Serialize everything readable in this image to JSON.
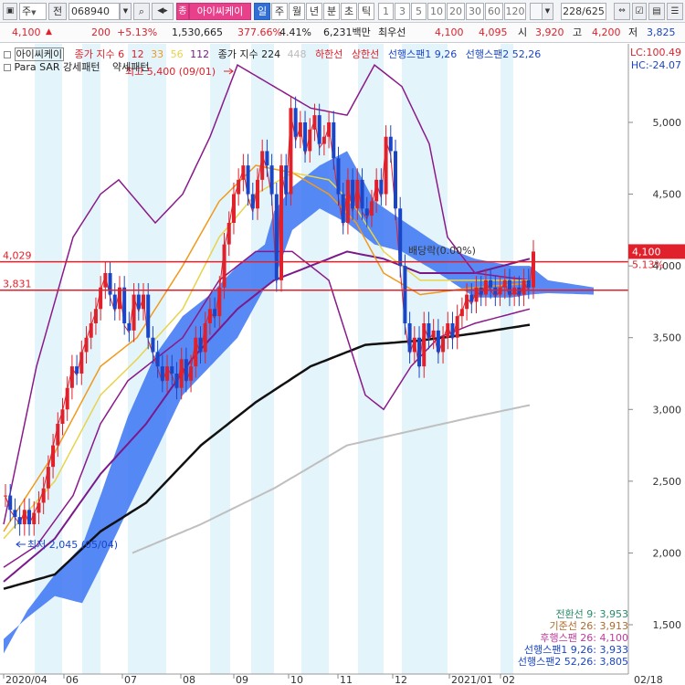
{
  "toolbar": {
    "market": "주",
    "code_prefix": "전",
    "code": "068940",
    "stock_name_badge": "종",
    "stock_name": "아이씨케이",
    "periods": [
      "일",
      "주",
      "월",
      "년",
      "분",
      "초",
      "틱"
    ],
    "active_period": "일",
    "intervals": [
      "1",
      "3",
      "5",
      "10",
      "20",
      "30",
      "60",
      "120"
    ],
    "page_counter": "228/625"
  },
  "quote": {
    "price": "4,100",
    "change": "200",
    "change_pct": "+5.13%",
    "volume": "1,530,665",
    "volume_ratio": "377.66%",
    "turnover": "4.41%",
    "amount": "6,231백만",
    "priority_label": "최우선",
    "ask": "4,100",
    "bid": "4,095",
    "open_label": "시",
    "open": "3,920",
    "high_label": "고",
    "high": "4,200",
    "low_label": "저",
    "low": "3,825"
  },
  "legend": {
    "stock_label": "아이씨케이",
    "ma_label": "종가 지수",
    "ma_values": [
      "6",
      "12",
      "33",
      "56",
      "112"
    ],
    "ma2_label": "종가 지수 224",
    "ma2_extra": "448",
    "band_low": "하한선",
    "band_high": "상한선",
    "span1": "선행스팬1 9,26",
    "span2": "선행스팬2 52,26",
    "lc": "LC:100.49",
    "hc": "HC:-24.07",
    "sar_label": "Para SAR 강세패턴",
    "sar_weak": "약세패턴"
  },
  "ichimoku_info": [
    "전환선 9: 3,953",
    "기준선 26: 3,913",
    "후행스팬 26: 4,100",
    "선행스팬1 9,26: 3,933",
    "선행스팬2 52,26: 3,805"
  ],
  "colors": {
    "up": "#e0202a",
    "down": "#1946c8",
    "cloud": "#3b74f2",
    "hline": "#e0202a",
    "ma224": "#111111",
    "ma448": "#bfbfbf"
  },
  "chart_data": {
    "type": "candlestick",
    "ylim": [
      1300,
      5500
    ],
    "yticks": [
      "5,000",
      "4,500",
      "4,000",
      "3,500",
      "3,000",
      "2,500",
      "2,000",
      "1,500"
    ],
    "ytick_values": [
      5000,
      4500,
      4000,
      3500,
      3000,
      2500,
      2000,
      1500
    ],
    "xticks": [
      "2020/04",
      "06",
      "07",
      "08",
      "09",
      "10",
      "11",
      "12",
      "2021/01",
      "02"
    ],
    "last_date": "02/18",
    "hlines": [
      {
        "label": "4,029",
        "value": 4029
      },
      {
        "label": "3,831",
        "value": 3831
      }
    ],
    "price_tag": "4,100",
    "price_tag_pct": "5.13%",
    "annotations": {
      "high": "최고 5,400 (09/01)",
      "low": "최저 2,045 (05/04)",
      "dividend": "배당락(0.00%)"
    },
    "closes": [
      2400,
      2300,
      2250,
      2200,
      2300,
      2200,
      2280,
      2350,
      2450,
      2600,
      2750,
      2900,
      3000,
      3150,
      3300,
      3250,
      3400,
      3500,
      3600,
      3700,
      3850,
      3950,
      3800,
      3700,
      3850,
      3600,
      3550,
      3800,
      3700,
      3800,
      3500,
      3400,
      3300,
      3200,
      3300,
      3250,
      3150,
      3350,
      3200,
      3300,
      3500,
      3400,
      3600,
      3700,
      3650,
      3850,
      4150,
      4300,
      4500,
      4600,
      4700,
      4500,
      4400,
      4600,
      4800,
      4700,
      4500,
      3900,
      4700,
      4500,
      5100,
      4900,
      5000,
      4800,
      4950,
      5050,
      4850,
      4900,
      5000,
      4750,
      4500,
      4300,
      4600,
      4400,
      4600,
      4400,
      4350,
      4450,
      4600,
      4500,
      4900,
      4800,
      4400,
      4000,
      3600,
      3400,
      3500,
      3300,
      3600,
      3500,
      3550,
      3400,
      3500,
      3600,
      3500,
      3650,
      3700,
      3800,
      3750,
      3850,
      3800,
      3900,
      3850,
      3800,
      3850,
      3900,
      3800,
      3850,
      3800,
      3900,
      3850,
      4100
    ]
  }
}
